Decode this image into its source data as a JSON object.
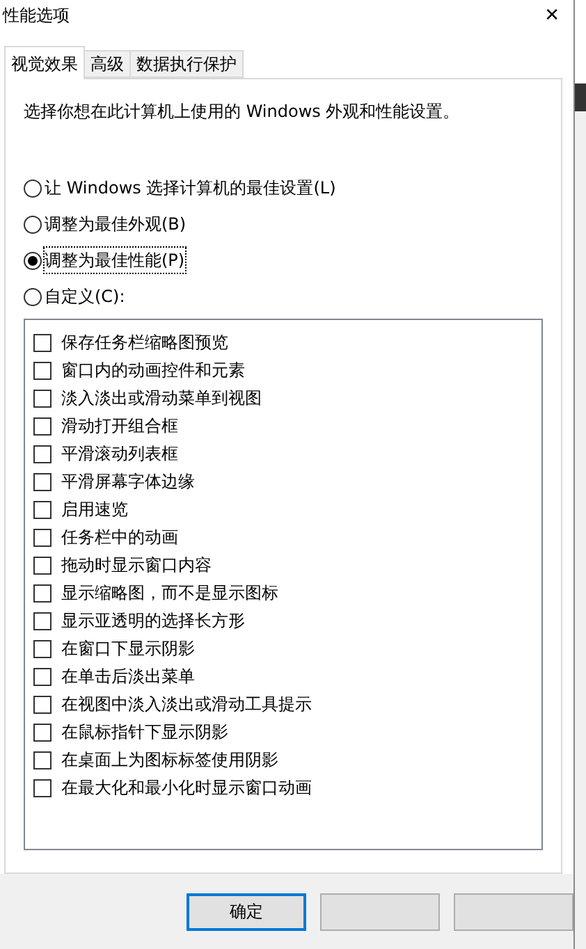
{
  "window": {
    "title": "性能选项",
    "close": "✕"
  },
  "tabs": [
    {
      "label": "视觉效果",
      "selected": true
    },
    {
      "label": "高级",
      "selected": false
    },
    {
      "label": "数据执行保护",
      "selected": false
    }
  ],
  "description": "选择你想在此计算机上使用的 Windows 外观和性能设置。",
  "options": [
    {
      "label": "让 Windows 选择计算机的最佳设置(L)",
      "selected": false
    },
    {
      "label": "调整为最佳外观(B)",
      "selected": false
    },
    {
      "label": "调整为最佳性能(P)",
      "selected": true
    },
    {
      "label": "自定义(C):",
      "selected": false
    }
  ],
  "effects": [
    {
      "label": "保存任务栏缩略图预览",
      "checked": false
    },
    {
      "label": "窗口内的动画控件和元素",
      "checked": false
    },
    {
      "label": "淡入淡出或滑动菜单到视图",
      "checked": false
    },
    {
      "label": "滑动打开组合框",
      "checked": false
    },
    {
      "label": "平滑滚动列表框",
      "checked": false
    },
    {
      "label": "平滑屏幕字体边缘",
      "checked": false
    },
    {
      "label": "启用速览",
      "checked": false
    },
    {
      "label": "任务栏中的动画",
      "checked": false
    },
    {
      "label": "拖动时显示窗口内容",
      "checked": false
    },
    {
      "label": "显示缩略图，而不是显示图标",
      "checked": false
    },
    {
      "label": "显示亚透明的选择长方形",
      "checked": false
    },
    {
      "label": "在窗口下显示阴影",
      "checked": false
    },
    {
      "label": "在单击后淡出菜单",
      "checked": false
    },
    {
      "label": "在视图中淡入淡出或滑动工具提示",
      "checked": false
    },
    {
      "label": "在鼠标指针下显示阴影",
      "checked": false
    },
    {
      "label": "在桌面上为图标标签使用阴影",
      "checked": false
    },
    {
      "label": "在最大化和最小化时显示窗口动画",
      "checked": false
    }
  ],
  "buttons": [
    {
      "kind": "default",
      "label": "确定"
    },
    {
      "kind": "blank"
    },
    {
      "kind": "blank"
    }
  ]
}
